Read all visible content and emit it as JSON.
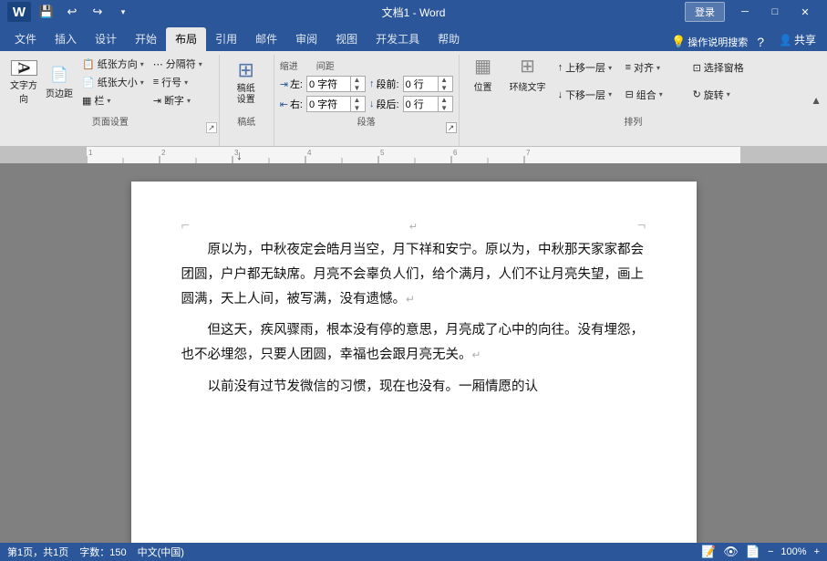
{
  "titlebar": {
    "title": "文档1 - Word",
    "quick_save": "💾",
    "quick_undo": "↩",
    "quick_redo": "↪",
    "login_label": "登录",
    "share_label": "共享",
    "help_label": "?",
    "min_label": "─",
    "max_label": "□",
    "close_label": "✕"
  },
  "tabs": {
    "items": [
      "文件",
      "插入",
      "设计",
      "开始",
      "布局",
      "引用",
      "邮件",
      "审阅",
      "视图",
      "开发工具",
      "帮助"
    ],
    "active": "布局"
  },
  "ribbon": {
    "groups": {
      "page_setup": {
        "label": "页面设置",
        "items": [
          {
            "label": "纸张方向▾",
            "icon": "📄"
          },
          {
            "label": "纸张大小▾",
            "icon": "📋"
          },
          {
            "label": "栏▾",
            "icon": "▦"
          },
          {
            "label": "分隔符▾",
            "icon": "⋯"
          },
          {
            "label": "行号▾",
            "icon": "≡"
          },
          {
            "label": "断字▾",
            "icon": "⇥"
          }
        ],
        "text_dir": {
          "label": "文字方向",
          "icon": "A"
        },
        "margins": {
          "label": "页边距"
        }
      },
      "paper": {
        "label": "稿纸",
        "large_label": "稿纸\n设置",
        "icon": "⊞"
      },
      "paragraph": {
        "label": "段落",
        "indent_left_label": "左:",
        "indent_right_label": "右:",
        "spacing_before_label": "段前:",
        "spacing_after_label": "段后:",
        "indent_left_val": "0 字符",
        "indent_right_val": "0 字符",
        "spacing_before_val": "0 行",
        "spacing_after_val": "0 行"
      },
      "arrange": {
        "label": "排列",
        "items": [
          {
            "label": "位置",
            "icon": "▦"
          },
          {
            "label": "环绕文字",
            "icon": "⊞"
          },
          {
            "label": "上移一层▾",
            "icon": "↑"
          },
          {
            "label": "下移一层▾",
            "icon": "↓"
          },
          {
            "label": "对齐▾",
            "icon": "≡"
          },
          {
            "label": "组合▾",
            "icon": "⊟"
          },
          {
            "label": "选择窗格",
            "icon": "⊡"
          },
          {
            "label": "旋转▾",
            "icon": "↻"
          }
        ]
      }
    }
  },
  "document": {
    "paragraphs": [
      {
        "text": "原以为，中秋夜定会皓月当空，月下祥和安宁。原以为，中秋那天家家都会团圆，户户都无缺席。月亮不会辜负人们，给个满月，人们不让月亮失望，画上圆满，天上人间，被写满，没有遗憾。",
        "indent": true,
        "has_enter": true
      },
      {
        "text": "但这天，疾风骤雨，根本没有停的意思，月亮成了心中的向往。没有埋怨，也不必埋怨，只要人团圆，幸福也会跟月亮无关。",
        "indent": true,
        "has_enter": true
      },
      {
        "text": "以前没有过节发微信的习惯，现在也没有。一厢情愿的认",
        "indent": true,
        "has_enter": false
      }
    ]
  },
  "statusbar": {
    "page_info": "第1页，共1页",
    "word_count": "字数：150",
    "lang": "中文(中国)"
  },
  "icons": {
    "search": "🔍",
    "light_bulb": "💡"
  }
}
